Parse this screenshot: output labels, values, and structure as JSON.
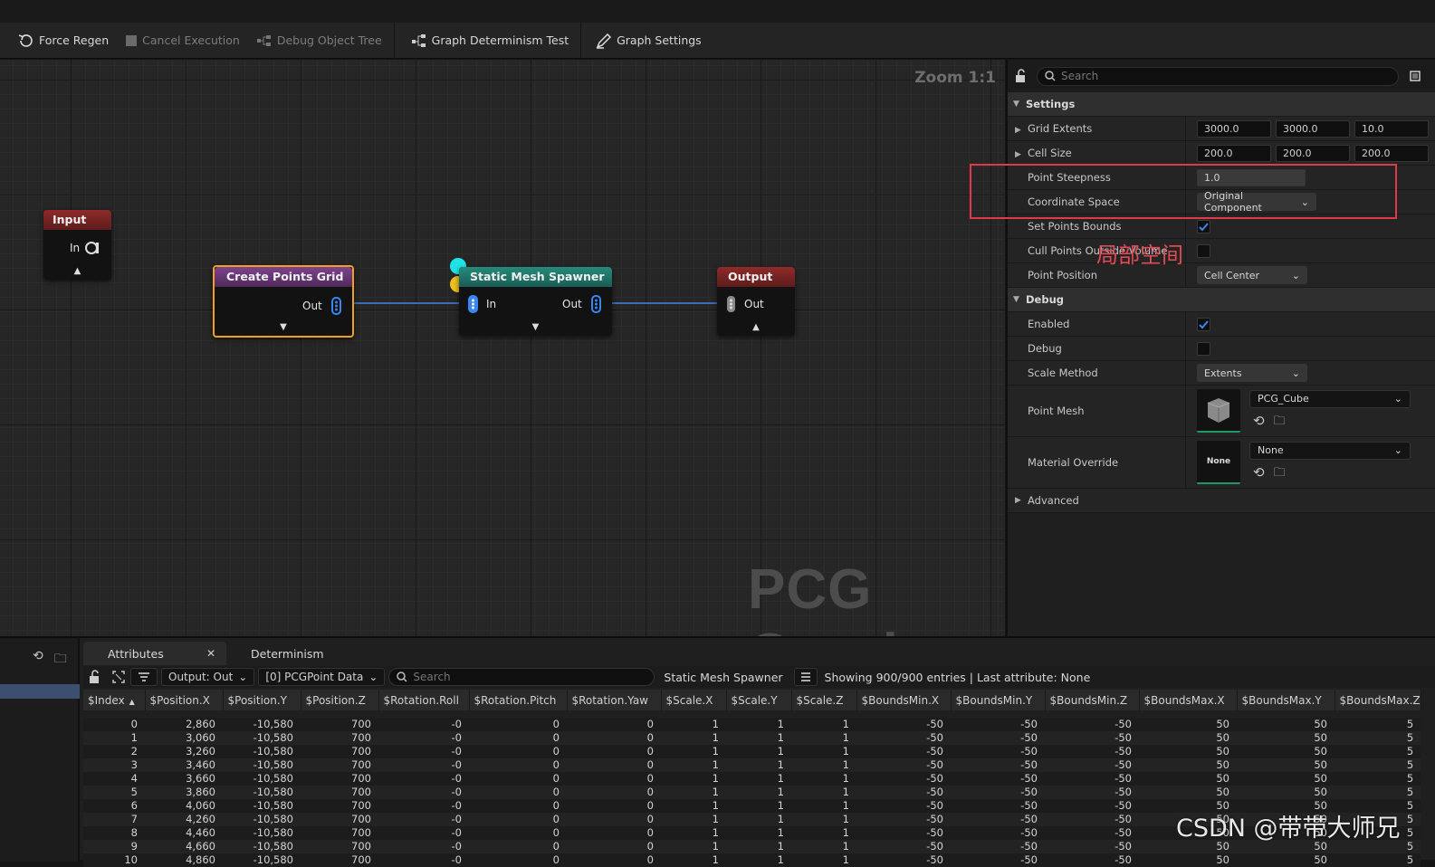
{
  "toolbar": {
    "force_regen": "Force Regen",
    "cancel_execution": "Cancel Execution",
    "debug_object_tree": "Debug Object Tree",
    "graph_determinism_test": "Graph Determinism Test",
    "graph_settings": "Graph Settings"
  },
  "graph": {
    "zoom": "Zoom 1:1",
    "watermark": "PCG Graph",
    "nodes": {
      "input": {
        "title": "Input",
        "pin_in": "In",
        "header_color": "#8a2a2a"
      },
      "create_points_grid": {
        "title": "Create Points Grid",
        "pin_out": "Out",
        "header_color": "#7b3f8a"
      },
      "static_mesh_spawner": {
        "title": "Static Mesh Spawner",
        "pin_in": "In",
        "pin_out": "Out",
        "header_color": "#25786e"
      },
      "output": {
        "title": "Output",
        "pin_out": "Out",
        "header_color": "#8a2a2a"
      }
    }
  },
  "details": {
    "search_placeholder": "Search",
    "settings_category": "Settings",
    "grid_extents": {
      "label": "Grid Extents",
      "x": "3000.0",
      "y": "3000.0",
      "z": "10.0"
    },
    "cell_size": {
      "label": "Cell Size",
      "x": "200.0",
      "y": "200.0",
      "z": "200.0"
    },
    "point_steepness": {
      "label": "Point Steepness",
      "value": "1.0"
    },
    "coordinate_space": {
      "label": "Coordinate Space",
      "value": "Original Component"
    },
    "set_points_bounds": {
      "label": "Set Points Bounds",
      "checked": true
    },
    "cull_points": {
      "label": "Cull Points Outside Volume",
      "checked": false
    },
    "point_position": {
      "label": "Point Position",
      "value": "Cell Center"
    },
    "debug_category": "Debug",
    "enabled": {
      "label": "Enabled",
      "checked": true
    },
    "debug": {
      "label": "Debug",
      "checked": false
    },
    "scale_method": {
      "label": "Scale Method",
      "value": "Extents"
    },
    "point_mesh": {
      "label": "Point Mesh",
      "value": "PCG_Cube"
    },
    "material_override": {
      "label": "Material Override",
      "value": "None",
      "thumb": "None"
    },
    "advanced": "Advanced",
    "annotation_cn": "局部空间"
  },
  "bottom": {
    "tabs": {
      "attributes": "Attributes",
      "determinism": "Determinism"
    },
    "output_combo": "Output: Out",
    "data_combo": "[0] PCGPoint Data",
    "search_placeholder": "Search",
    "node_name": "Static Mesh Spawner",
    "status": "Showing 900/900 entries | Last attribute: None",
    "columns": [
      "$Index",
      "$Position.X",
      "$Position.Y",
      "$Position.Z",
      "$Rotation.Roll",
      "$Rotation.Pitch",
      "$Rotation.Yaw",
      "$Scale.X",
      "$Scale.Y",
      "$Scale.Z",
      "$BoundsMin.X",
      "$BoundsMin.Y",
      "$BoundsMin.Z",
      "$BoundsMax.X",
      "$BoundsMax.Y",
      "$BoundsMax.Z"
    ],
    "rows": [
      [
        "0",
        "2,860",
        "-10,580",
        "700",
        "-0",
        "0",
        "0",
        "1",
        "1",
        "1",
        "-50",
        "-50",
        "-50",
        "50",
        "50",
        "5"
      ],
      [
        "1",
        "3,060",
        "-10,580",
        "700",
        "-0",
        "0",
        "0",
        "1",
        "1",
        "1",
        "-50",
        "-50",
        "-50",
        "50",
        "50",
        "5"
      ],
      [
        "2",
        "3,260",
        "-10,580",
        "700",
        "-0",
        "0",
        "0",
        "1",
        "1",
        "1",
        "-50",
        "-50",
        "-50",
        "50",
        "50",
        "5"
      ],
      [
        "3",
        "3,460",
        "-10,580",
        "700",
        "-0",
        "0",
        "0",
        "1",
        "1",
        "1",
        "-50",
        "-50",
        "-50",
        "50",
        "50",
        "5"
      ],
      [
        "4",
        "3,660",
        "-10,580",
        "700",
        "-0",
        "0",
        "0",
        "1",
        "1",
        "1",
        "-50",
        "-50",
        "-50",
        "50",
        "50",
        "5"
      ],
      [
        "5",
        "3,860",
        "-10,580",
        "700",
        "-0",
        "0",
        "0",
        "1",
        "1",
        "1",
        "-50",
        "-50",
        "-50",
        "50",
        "50",
        "5"
      ],
      [
        "6",
        "4,060",
        "-10,580",
        "700",
        "-0",
        "0",
        "0",
        "1",
        "1",
        "1",
        "-50",
        "-50",
        "-50",
        "50",
        "50",
        "5"
      ],
      [
        "7",
        "4,260",
        "-10,580",
        "700",
        "-0",
        "0",
        "0",
        "1",
        "1",
        "1",
        "-50",
        "-50",
        "-50",
        "50",
        "50",
        "5"
      ],
      [
        "8",
        "4,460",
        "-10,580",
        "700",
        "-0",
        "0",
        "0",
        "1",
        "1",
        "1",
        "-50",
        "-50",
        "-50",
        "50",
        "50",
        "5"
      ],
      [
        "9",
        "4,660",
        "-10,580",
        "700",
        "-0",
        "0",
        "0",
        "1",
        "1",
        "1",
        "-50",
        "-50",
        "-50",
        "50",
        "50",
        "5"
      ],
      [
        "10",
        "4,860",
        "-10,580",
        "700",
        "-0",
        "0",
        "0",
        "1",
        "1",
        "1",
        "-50",
        "-50",
        "-50",
        "50",
        "50",
        "5"
      ]
    ]
  },
  "watermark_csdn": "CSDN @带带大师兄"
}
